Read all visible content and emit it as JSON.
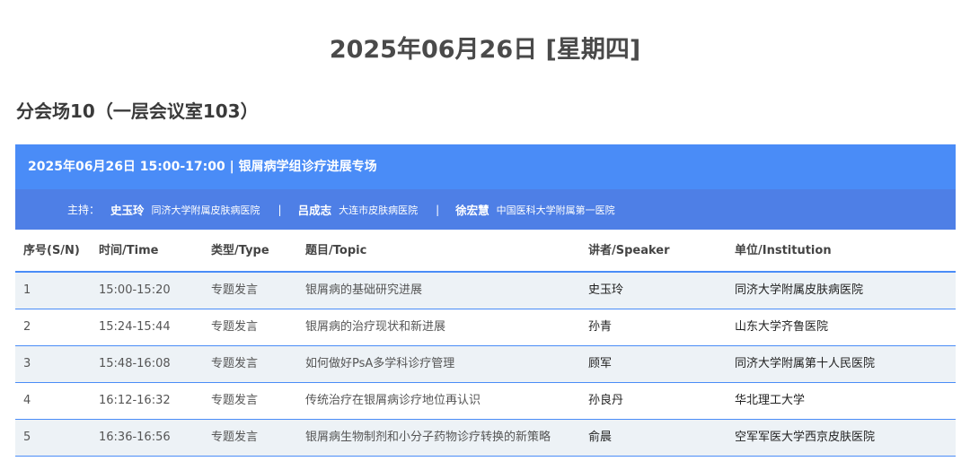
{
  "page": {
    "date_title": "2025年06月26日 [星期四]",
    "venue_title": "分会场10（一层会议室103）"
  },
  "session": {
    "title": "2025年06月26日 15:00-17:00 | 银屑病学组诊疗进展专场",
    "hosts_label": "主持：",
    "separator": "|",
    "hosts": [
      {
        "name": "史玉玲",
        "org": "同济大学附属皮肤病医院"
      },
      {
        "name": "吕成志",
        "org": "大连市皮肤病医院"
      },
      {
        "name": "徐宏慧",
        "org": "中国医科大学附属第一医院"
      }
    ]
  },
  "table": {
    "headers": [
      "序号(S/N)",
      "时间/Time",
      "类型/Type",
      "题目/Topic",
      "讲者/Speaker",
      "单位/Institution"
    ],
    "rows": [
      [
        "1",
        "15:00-15:20",
        "专题发言",
        "银屑病的基础研究进展",
        "史玉玲",
        "同济大学附属皮肤病医院"
      ],
      [
        "2",
        "15:24-15:44",
        "专题发言",
        "银屑病的治疗现状和新进展",
        "孙青",
        "山东大学齐鲁医院"
      ],
      [
        "3",
        "15:48-16:08",
        "专题发言",
        "如何做好PsA多学科诊疗管理",
        "顾军",
        "同济大学附属第十人民医院"
      ],
      [
        "4",
        "16:12-16:32",
        "专题发言",
        "传统治疗在银屑病诊疗地位再认识",
        "孙良丹",
        "华北理工大学"
      ],
      [
        "5",
        "16:36-16:56",
        "专题发言",
        "银屑病生物制剂和小分子药物诊疗转换的新策略",
        "俞晨",
        "空军军医大学西京皮肤医院"
      ]
    ]
  },
  "colors": {
    "header_blue": "#4a8cf7",
    "hosts_blue": "#4e7fe6",
    "row_alt": "#edf2f6"
  }
}
